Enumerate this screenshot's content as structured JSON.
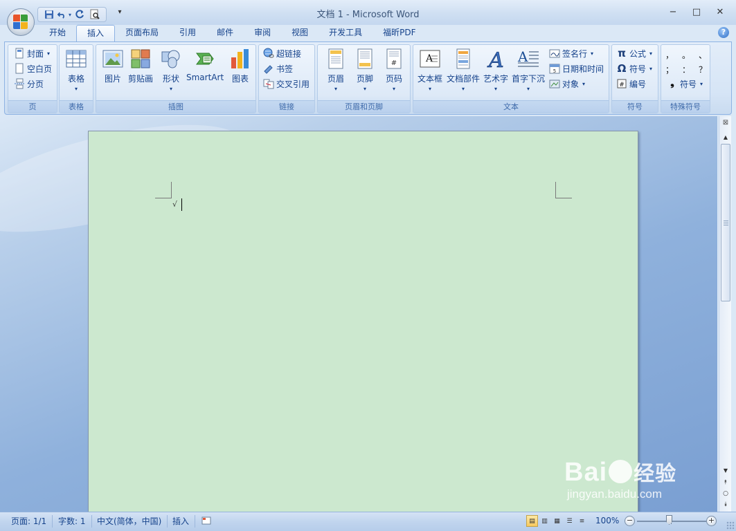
{
  "window": {
    "title": "文档 1 - Microsoft Word",
    "controls": [
      "−",
      "□",
      "✕"
    ]
  },
  "quick_access": {
    "items": [
      "save-icon",
      "undo-icon",
      "redo-icon",
      "print-preview-icon"
    ]
  },
  "tabs": [
    {
      "label": "开始"
    },
    {
      "label": "插入",
      "active": true
    },
    {
      "label": "页面布局"
    },
    {
      "label": "引用"
    },
    {
      "label": "邮件"
    },
    {
      "label": "审阅"
    },
    {
      "label": "视图"
    },
    {
      "label": "开发工具"
    },
    {
      "label": "福昕PDF"
    }
  ],
  "ribbon": {
    "pages": {
      "label": "页",
      "cover": "封面",
      "blank": "空白页",
      "break": "分页"
    },
    "tables": {
      "label": "表格",
      "table": "表格"
    },
    "illustrations": {
      "label": "插图",
      "picture": "图片",
      "clipart": "剪贴画",
      "shapes": "形状",
      "smartart": "SmartArt",
      "chart": "图表"
    },
    "links": {
      "label": "链接",
      "hyperlink": "超链接",
      "bookmark": "书签",
      "crossref": "交叉引用"
    },
    "header_footer": {
      "label": "页眉和页脚",
      "header": "页眉",
      "footer": "页脚",
      "page_number": "页码"
    },
    "text": {
      "label": "文本",
      "textbox": "文本框",
      "quickparts": "文档部件",
      "wordart": "艺术字",
      "dropcap": "首字下沉",
      "signature": "签名行",
      "datetime": "日期和时间",
      "object": "对象"
    },
    "symbols": {
      "label": "符号",
      "equation": "公式",
      "symbol": "符号",
      "numbering": "编号"
    },
    "special": {
      "label": "特殊符号",
      "row1": [
        "，",
        "。",
        "、"
      ],
      "row2": [
        "；",
        "：",
        "？"
      ],
      "symbol": "符号"
    }
  },
  "status": {
    "page": "页面: 1/1",
    "words": "字数: 1",
    "language": "中文(简体，中国)",
    "mode": "插入",
    "zoom": "100%"
  },
  "watermark": {
    "main": "Bai",
    "mid": "经验",
    "sub": "jingyan.baidu.com"
  },
  "colors": {
    "page": "#cce8cf",
    "ribbon": "#dbe8f6",
    "accent": "#15428b"
  }
}
